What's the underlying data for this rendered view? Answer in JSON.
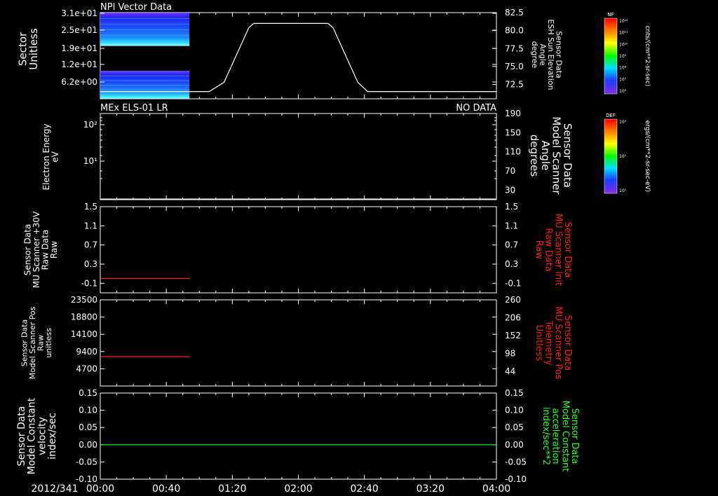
{
  "colors": {
    "background": "#000000",
    "axis": "#ffffff",
    "white_trace": "#ffffff",
    "red_trace": "#ff2020",
    "green_trace": "#00ff00",
    "red_label": "#ff1a1a",
    "green_label": "#22ff22"
  },
  "time_axis": {
    "date_label": "2012/341",
    "tick_labels": [
      "00:00",
      "00:40",
      "01:20",
      "02:00",
      "02:40",
      "03:20",
      "04:00"
    ],
    "range_hours": [
      0,
      4
    ]
  },
  "colorbars": [
    {
      "label": "NF",
      "unit_text": "cnts/(cm**2-sr-sec)",
      "tick_labels": [
        "10¹²",
        "10¹¹",
        "10¹⁰",
        "10⁹",
        "10⁸",
        "10⁷",
        "10⁶"
      ]
    },
    {
      "label": "DEF",
      "unit_text": "ergs/(cm**2-sr-sec-eV)",
      "tick_labels": [
        "10⁴",
        "10¹",
        "10¹"
      ]
    }
  ],
  "chart_data": [
    {
      "type": "heatmap",
      "title": "NPI Vector Data",
      "ylabel": [
        "Sector",
        "Unitless"
      ],
      "y_tick_labels": [
        "3.1e+01",
        "2.5e+01",
        "1.9e+01",
        "1.2e+01",
        "6.2e+00"
      ],
      "ylim": [
        0,
        31
      ],
      "blocks": [
        {
          "t0": 0.0,
          "t1": 0.9,
          "y0": 19,
          "y1": 31
        },
        {
          "t0": 0.0,
          "t1": 0.9,
          "y0": 0,
          "y1": 10
        }
      ],
      "overlay_line": {
        "ylabel": [
          "Sensor Data",
          "ESH Sun Elevation",
          "Angle",
          "degree"
        ],
        "ylim": [
          70.5,
          82.5
        ],
        "y_tick_labels": [
          "82.5",
          "80.0",
          "77.5",
          "75.0",
          "72.5"
        ],
        "x_hours": [
          0,
          1.1,
          1.25,
          1.5,
          1.55,
          2.3,
          2.35,
          2.6,
          2.7,
          4
        ],
        "values": [
          71.5,
          71.5,
          72.8,
          80.4,
          81.0,
          81.0,
          80.4,
          72.8,
          71.5,
          71.5
        ]
      }
    },
    {
      "type": "line",
      "title": "MEx ELS-01 LR",
      "status": "NO DATA",
      "ylabel": [
        "Electron Energy",
        "eV"
      ],
      "y_tick_labels": [
        "10²",
        "10¹"
      ],
      "right_ylabel": [
        "Sensor Data",
        "Model Scanner",
        "Angle",
        "degrees"
      ],
      "right_ylim": [
        10,
        190
      ],
      "right_y_tick_labels": [
        "190",
        "150",
        "110",
        "70",
        "30"
      ],
      "series": [
        {
          "x_hours": [
            0,
            4
          ],
          "values": [
            10,
            10
          ]
        }
      ]
    },
    {
      "type": "line",
      "ylabel": [
        "Sensor Data",
        "MU Scanner +30V",
        "Raw Data",
        "Raw"
      ],
      "ylim": [
        -0.3,
        1.5
      ],
      "y_tick_labels": [
        "1.5",
        "1.1",
        "0.7",
        "0.3",
        "-0.1"
      ],
      "right_ylabel": [
        "Sensor Data",
        "MU Scanner Init",
        "Raw Data",
        "Raw"
      ],
      "right_ylim": [
        -0.3,
        1.5
      ],
      "right_y_tick_labels": [
        "1.5",
        "1.1",
        "0.7",
        "0.3",
        "-0.1"
      ],
      "series": [
        {
          "x_hours": [
            0,
            0.9
          ],
          "values": [
            0,
            0
          ]
        }
      ]
    },
    {
      "type": "line",
      "ylabel": [
        "Sensor Data",
        "Model Scanner Pos",
        "Raw",
        "unitless"
      ],
      "ylim": [
        0,
        23500
      ],
      "y_tick_labels": [
        "23500",
        "18800",
        "14100",
        "9400",
        "4700"
      ],
      "right_ylabel": [
        "Sensor Data",
        "MU Scanner Pos",
        "Telemetry",
        "Unitless"
      ],
      "right_ylim": [
        0,
        260
      ],
      "right_y_tick_labels": [
        "260",
        "206",
        "152",
        "98",
        "44"
      ],
      "series": [
        {
          "x_hours": [
            0,
            0.9
          ],
          "values": [
            8000,
            8000
          ]
        }
      ]
    },
    {
      "type": "line",
      "ylabel": [
        "Sensor Data",
        "Model Constant",
        "velocity",
        "index/sec"
      ],
      "ylim": [
        -0.1,
        0.15
      ],
      "y_tick_labels": [
        "0.15",
        "0.10",
        "0.05",
        "0.00",
        "-0.05",
        "-0.10"
      ],
      "right_ylabel": [
        "Sensor Data",
        "Model Constant",
        "acceleration",
        "index/sec**2"
      ],
      "right_ylim": [
        -0.1,
        0.15
      ],
      "right_y_tick_labels": [
        "0.15",
        "0.10",
        "0.05",
        "0.00",
        "-0.05",
        "-0.10"
      ],
      "series": [
        {
          "x_hours": [
            0,
            4
          ],
          "values": [
            0,
            0
          ]
        }
      ]
    }
  ]
}
